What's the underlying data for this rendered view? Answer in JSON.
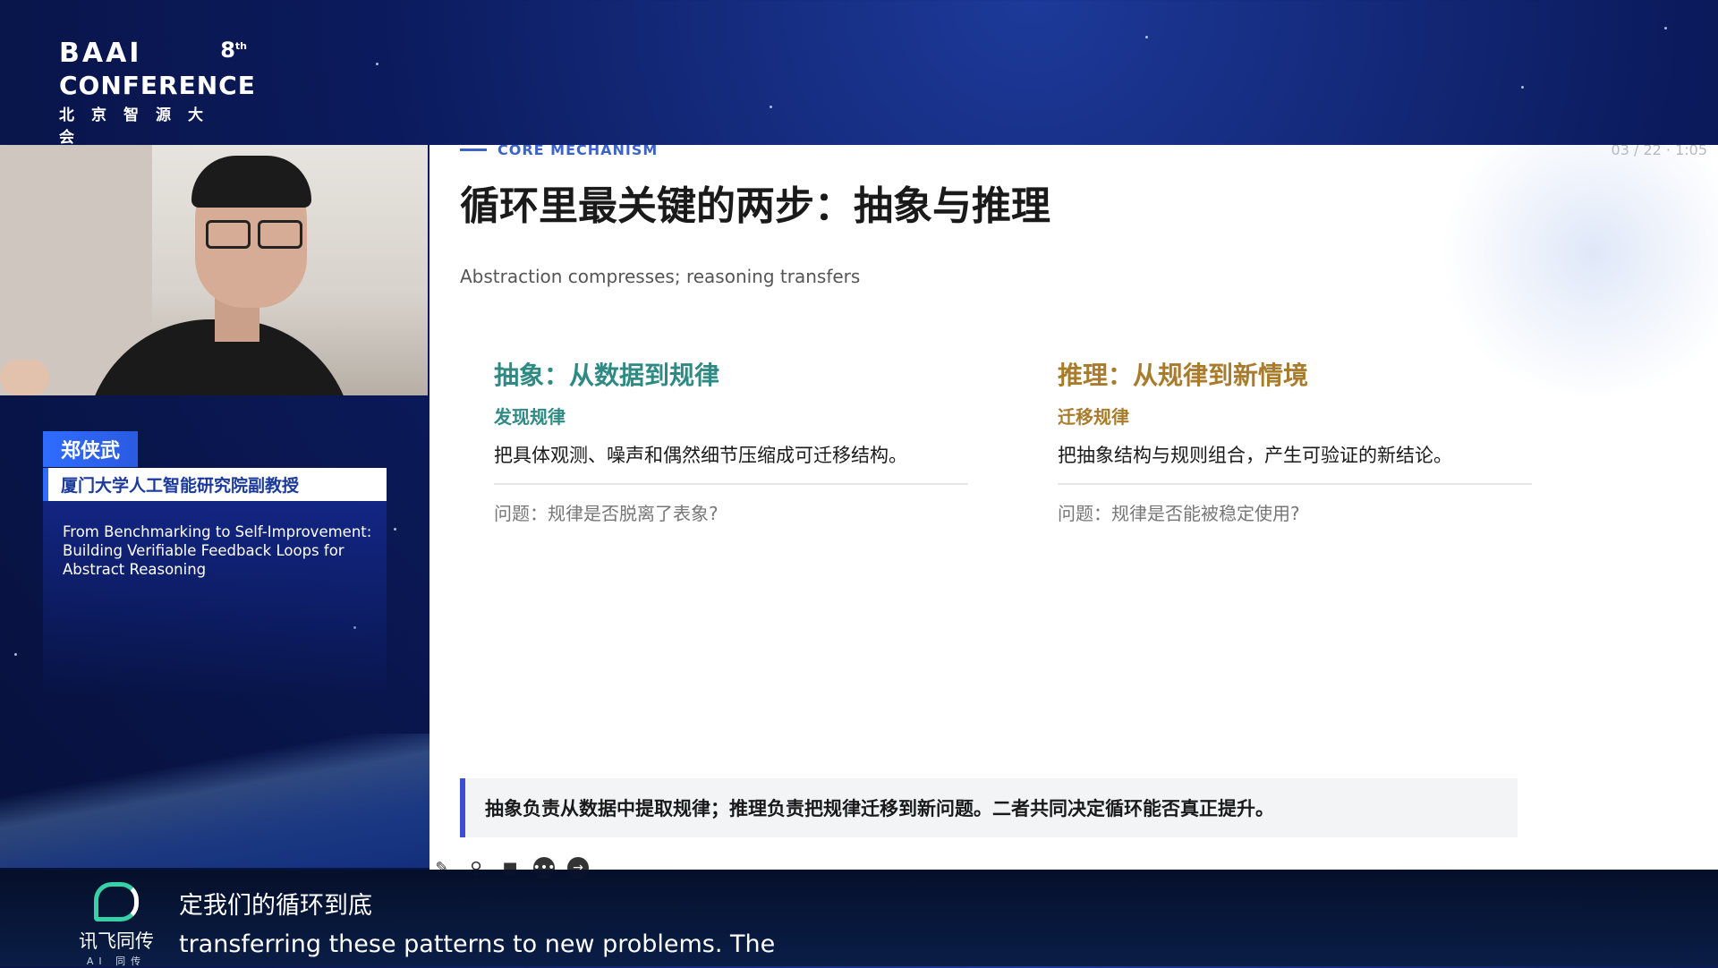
{
  "header": {
    "logo_main": "BAAI",
    "logo_edition": "8",
    "logo_edition_suffix": "th",
    "logo_conference": "CONFERENCE",
    "logo_chinese": "北京智源大会"
  },
  "speaker": {
    "name": "郑侠武",
    "affiliation": "厦门大学人工智能研究院副教授",
    "talk_title": "From Benchmarking to Self-Improvement: Building Verifiable Feedback Loops for Abstract Reasoning"
  },
  "slide": {
    "kicker": "CORE MECHANISM",
    "meta": "03 / 22 · 1:05",
    "title": "循环里最关键的两步：抽象与推理",
    "subtitle": "Abstraction compresses; reasoning transfers",
    "left": {
      "heading": "抽象：从数据到规律",
      "subheading": "发现规律",
      "description": "把具体观测、噪声和偶然细节压缩成可迁移结构。",
      "question": "问题：规律是否脱离了表象?"
    },
    "right": {
      "heading": "推理：从规律到新情境",
      "subheading": "迁移规律",
      "description": "把抽象结构与规则组合，产生可验证的新结论。",
      "question": "问题：规律是否能被稳定使用?"
    },
    "callout": "抽象负责从数据中提取规律；推理负责把规律迁移到新问题。二者共同决定循环能否真正提升。"
  },
  "toolbar": {
    "icons": [
      "pencil-icon",
      "magnifier-icon",
      "camera-icon",
      "more-icon",
      "arrow-right-icon"
    ]
  },
  "caption": {
    "brand": "讯飞同传",
    "brand_sub": "AI 同传",
    "line_cn": "定我们的循环到底",
    "line_en": "transferring these patterns to new problems. The"
  },
  "colors": {
    "abstraction_accent": "#2e8a83",
    "reasoning_accent": "#a97c2c",
    "kicker_blue": "#3b63c9",
    "callout_bar": "#3b4fd6",
    "name_tag_blue": "#2f6dff"
  }
}
